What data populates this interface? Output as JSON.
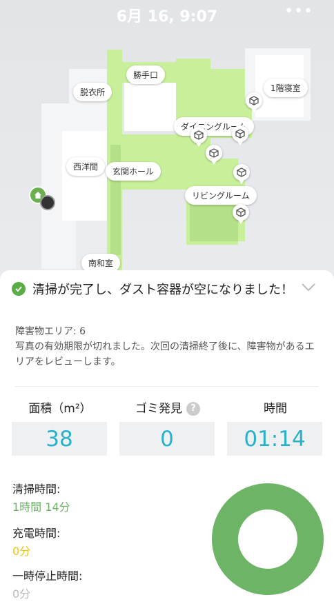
{
  "header": {
    "title": "6月 16, 9:07",
    "more": "•••"
  },
  "map": {
    "rooms": [
      "勝手口",
      "脱衣所",
      "1階寝室",
      "ダイニングルーム",
      "西洋間",
      "玄関ホール",
      "リビングルーム",
      "南和室"
    ]
  },
  "result": {
    "status": "清掃が完了し、ダスト容器が空になりました！",
    "obstacle_area": "障害物エリア: 6",
    "notice": "写真の有効期限が切れました。次回の清掃終了後に、障害物があるエリアをレビューします。"
  },
  "stats": [
    {
      "label": "面積（m²）",
      "value": "38"
    },
    {
      "label": "ゴミ発見",
      "value": "0",
      "help": "?"
    },
    {
      "label": "時間",
      "value": "01:14"
    }
  ],
  "times": {
    "cleaning_label": "清掃時間:",
    "cleaning_value": "1時間 14分",
    "charging_label": "充電時間:",
    "charging_value": "0分",
    "pause_label": "一時停止時間:",
    "pause_value": "0分"
  },
  "colors": {
    "accent": "#29b1c9",
    "green": "#6db466",
    "yellow": "#f1c40f",
    "map_floor": "#c7f19a"
  },
  "donut": {
    "cleaning_fraction": 1.0
  }
}
